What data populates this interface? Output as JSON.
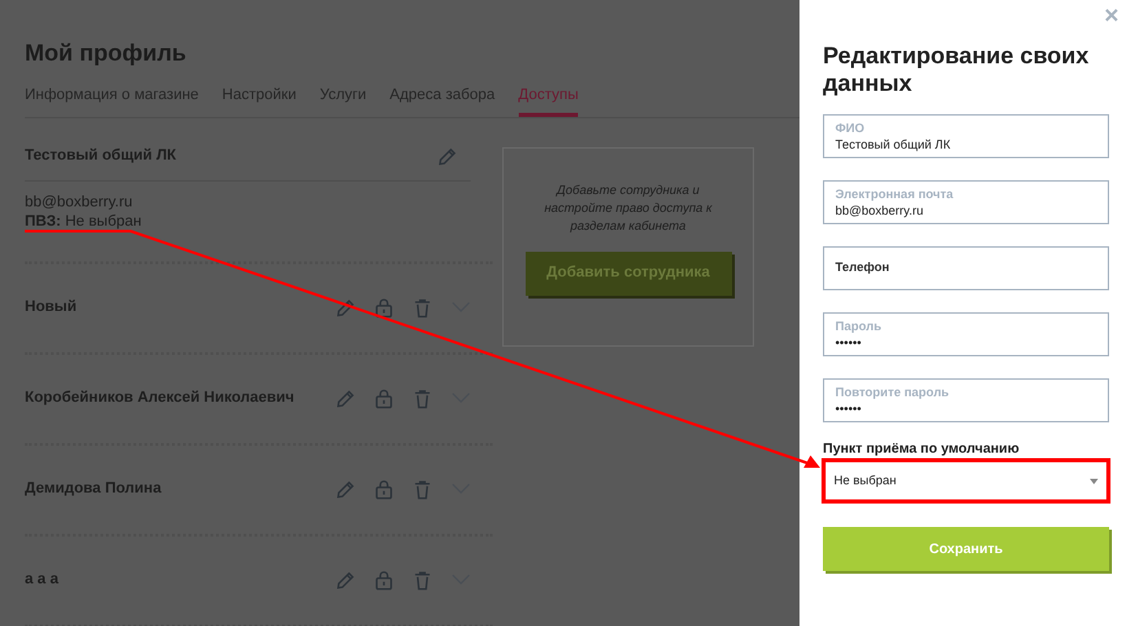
{
  "page": {
    "title": "Мой профиль"
  },
  "tabs": [
    {
      "label": "Информация о магазине",
      "selected": false
    },
    {
      "label": "Настройки",
      "selected": false
    },
    {
      "label": "Услуги",
      "selected": false
    },
    {
      "label": "Адреса забора",
      "selected": false
    },
    {
      "label": "Доступы",
      "selected": true
    }
  ],
  "owner": {
    "name": "Тестовый общий ЛК",
    "email": "bb@boxberry.ru",
    "pickup": "**ПВЗ:** Не выбран"
  },
  "employees": [
    {
      "name": "Новый"
    },
    {
      "name": "Коробейников Алексей Николаевич"
    },
    {
      "name": "Демидова Полина"
    },
    {
      "name": "а а а"
    }
  ],
  "invite": {
    "text": "Добавьте сотрудника и настройте право доступа к разделам кабинета",
    "button": "Добавить сотрудника"
  },
  "drawer": {
    "close": "×",
    "title": "Редактирование своих данных",
    "fields": [
      {
        "label": "ФИО",
        "value": "Тестовый общий ЛК"
      },
      {
        "label": "Электронная почта",
        "value": "bb@boxberry.ru"
      },
      {
        "placeholder": "Телефон"
      },
      {
        "label": "Пароль",
        "value": "••••••"
      },
      {
        "label": "Повторите пароль",
        "value": "••••••"
      }
    ],
    "select_label": "Пункт приёма по умолчанию",
    "select_value": "Не выбран",
    "save": "Сохранить"
  }
}
